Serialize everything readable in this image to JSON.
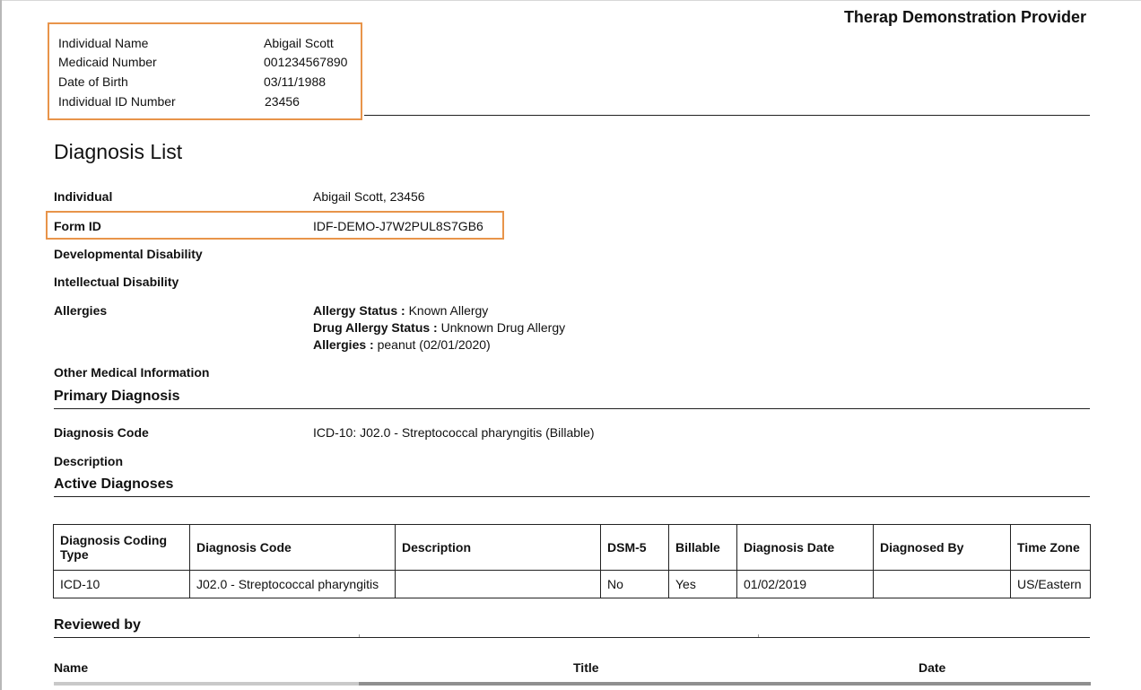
{
  "provider": "Therap Demonstration Provider",
  "individual_info": {
    "rows": [
      {
        "label": "Individual Name",
        "value": "Abigail Scott"
      },
      {
        "label": "Medicaid Number",
        "value": "001234567890"
      },
      {
        "label": "Date of Birth",
        "value": "03/11/1988"
      },
      {
        "label": "Individual ID Number",
        "value": "23456"
      }
    ]
  },
  "title": "Diagnosis List",
  "fields": {
    "individual": {
      "label": "Individual",
      "value": "Abigail Scott, 23456"
    },
    "form_id": {
      "label": "Form ID",
      "value": "IDF-DEMO-J7W2PUL8S7GB6"
    },
    "developmental_disability": {
      "label": "Developmental Disability",
      "value": ""
    },
    "intellectual_disability": {
      "label": "Intellectual Disability",
      "value": ""
    },
    "allergies": {
      "label": "Allergies",
      "allergy_status_label": "Allergy Status :",
      "allergy_status_value": "Known Allergy",
      "drug_allergy_status_label": "Drug Allergy Status :",
      "drug_allergy_status_value": "Unknown Drug Allergy",
      "allergies_label": "Allergies :",
      "allergies_value": "peanut (02/01/2020)"
    },
    "other_medical_information": {
      "label": "Other Medical Information",
      "value": ""
    }
  },
  "primary_diagnosis": {
    "heading": "Primary Diagnosis",
    "diagnosis_code_label": "Diagnosis Code",
    "diagnosis_code_value": "ICD-10: J02.0 - Streptococcal pharyngitis (Billable)",
    "description_label": "Description",
    "description_value": ""
  },
  "active_diagnoses": {
    "heading": "Active Diagnoses",
    "columns": [
      "Diagnosis Coding Type",
      "Diagnosis Code",
      "Description",
      "DSM-5",
      "Billable",
      "Diagnosis Date",
      "Diagnosed By",
      "Time Zone"
    ],
    "rows": [
      [
        "ICD-10",
        "J02.0 - Streptococcal pharyngitis",
        "",
        "No",
        "Yes",
        "01/02/2019",
        "",
        "US/Eastern"
      ]
    ]
  },
  "reviewed_by": {
    "heading": "Reviewed by",
    "columns": [
      "Name",
      "Title",
      "Date"
    ]
  }
}
